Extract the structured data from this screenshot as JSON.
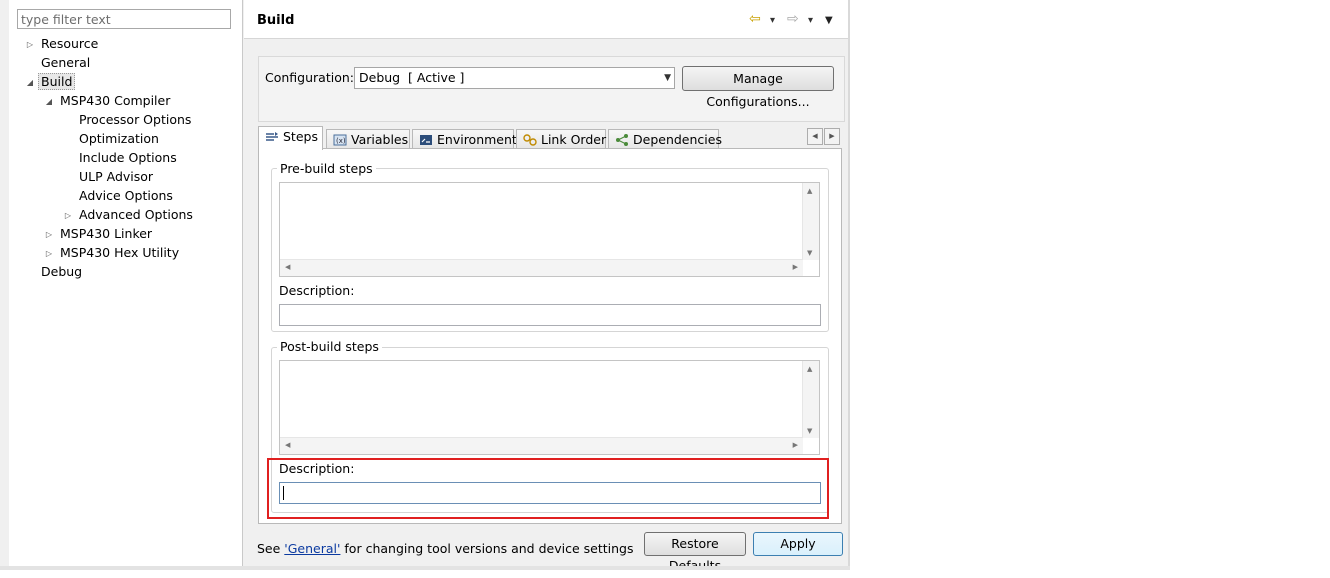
{
  "tree": {
    "filter_placeholder": "type filter text",
    "items": [
      {
        "label": "Resource",
        "twisty": "▷"
      },
      {
        "label": "General",
        "twisty": ""
      },
      {
        "label": "Build",
        "twisty": "◢"
      },
      {
        "label": "MSP430 Compiler",
        "twisty": "◢"
      },
      {
        "label": "Processor Options",
        "twisty": ""
      },
      {
        "label": "Optimization",
        "twisty": ""
      },
      {
        "label": "Include Options",
        "twisty": ""
      },
      {
        "label": "ULP Advisor",
        "twisty": ""
      },
      {
        "label": "Advice Options",
        "twisty": ""
      },
      {
        "label": "Advanced Options",
        "twisty": "▷"
      },
      {
        "label": "MSP430 Linker",
        "twisty": "▷"
      },
      {
        "label": "MSP430 Hex Utility",
        "twisty": "▷"
      },
      {
        "label": "Debug",
        "twisty": ""
      }
    ]
  },
  "header": {
    "title": "Build",
    "nav_back_icon": "⇦",
    "nav_forward_icon": "⇨",
    "dropdown_icon": "▾",
    "menu_icon": "▼"
  },
  "configuration": {
    "label": "Configuration:",
    "value": "Debug  [ Active ]",
    "manage_label": "Manage Configurations..."
  },
  "tabs": [
    {
      "label": "Steps",
      "icon": "steps-icon",
      "active": true
    },
    {
      "label": "Variables",
      "icon": "variables-icon",
      "active": false
    },
    {
      "label": "Environment",
      "icon": "environment-icon",
      "active": false
    },
    {
      "label": "Link Order",
      "icon": "link-order-icon",
      "active": false
    },
    {
      "label": "Dependencies",
      "icon": "dependencies-icon",
      "active": false
    }
  ],
  "steps": {
    "pre_build": {
      "legend": "Pre-build steps",
      "description_label": "Description:",
      "description_value": ""
    },
    "post_build": {
      "legend": "Post-build steps",
      "description_label": "Description:",
      "description_value": ""
    }
  },
  "footer": {
    "prefix": "See ",
    "link": "'General'",
    "suffix": " for changing tool versions and device settings",
    "restore_label": "Restore Defaults",
    "apply_label": "Apply"
  },
  "colors": {
    "highlight": "#e02020",
    "link": "#0b3aa0"
  }
}
